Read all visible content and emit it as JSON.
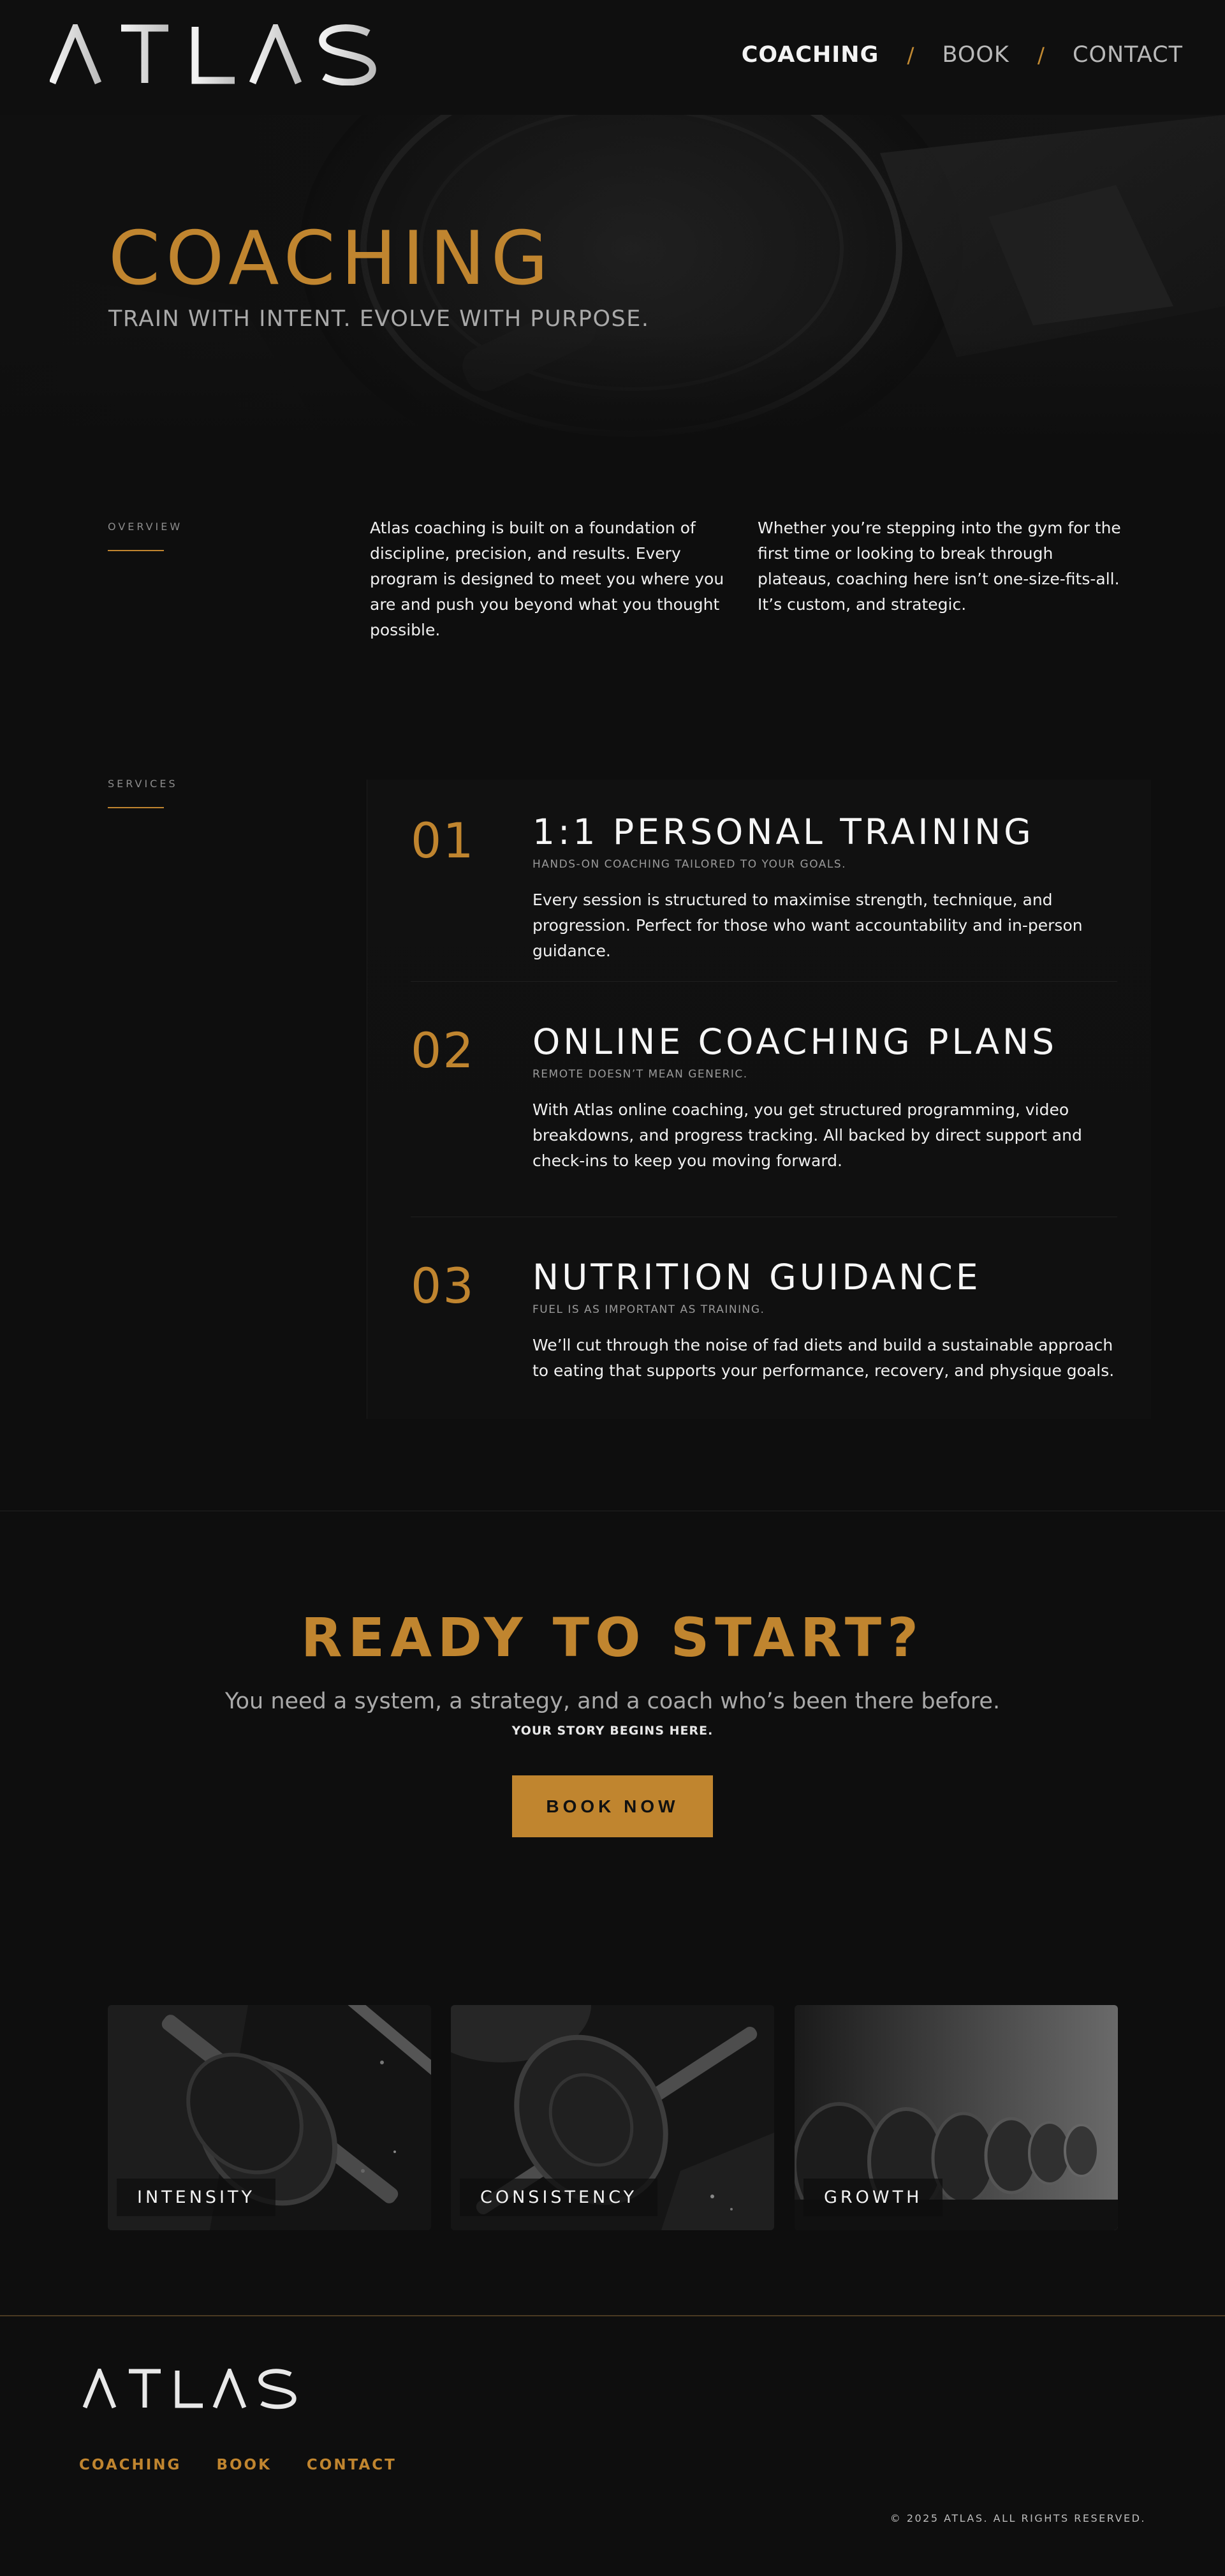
{
  "brand": {
    "logo_text": "ATLAS"
  },
  "nav": {
    "items": [
      "COACHING",
      "BOOK",
      "CONTACT"
    ],
    "separator": "/"
  },
  "hero": {
    "title": "COACHING",
    "subtitle": "TRAIN WITH INTENT. EVOLVE WITH PURPOSE."
  },
  "overview": {
    "label": "OVERVIEW",
    "col1": "Atlas coaching is built on a foundation of discipline, precision, and results. Every program is designed to meet you where you are and push you beyond what you thought possible.",
    "col2": "Whether you’re stepping into the gym for the first time or looking to break through plateaus, coaching here isn’t one-size-fits-all. It’s custom, and strategic."
  },
  "services": {
    "label": "SERVICES",
    "items": [
      {
        "number": "01",
        "title": "1:1 PERSONAL TRAINING",
        "tagline": "HANDS-ON COACHING TAILORED TO YOUR GOALS.",
        "description": "Every session is structured to maximise strength, technique, and progression. Perfect for those who want accountability and in-person guidance."
      },
      {
        "number": "02",
        "title": "ONLINE COACHING PLANS",
        "tagline": "REMOTE DOESN’T MEAN GENERIC.",
        "description": "With Atlas online coaching, you get structured programming, video breakdowns, and progress tracking. All backed by direct support and check-ins to keep you moving forward."
      },
      {
        "number": "03",
        "title": "NUTRITION GUIDANCE",
        "tagline": "FUEL IS AS IMPORTANT AS TRAINING.",
        "description": "We’ll cut through the noise of fad diets and build a sustainable approach to eating that supports your performance, recovery, and physique goals."
      }
    ]
  },
  "cta": {
    "title": "READY TO START?",
    "subtitle": "You need a system, a strategy, and a coach who’s been there before.",
    "small": "YOUR STORY BEGINS HERE.",
    "button": "BOOK NOW"
  },
  "gallery": {
    "labels": [
      "INTENSITY",
      "CONSISTENCY",
      "GROWTH"
    ]
  },
  "footer": {
    "logo_text": "ATLAS",
    "links": [
      "COACHING",
      "BOOK",
      "CONTACT"
    ],
    "copyright": "© 2025 ATLAS. ALL RIGHTS RESERVED."
  },
  "colors": {
    "accent": "#c0852f",
    "background": "#0e0e0e",
    "text": "#f0f0f0",
    "muted": "#a9a9a9"
  }
}
